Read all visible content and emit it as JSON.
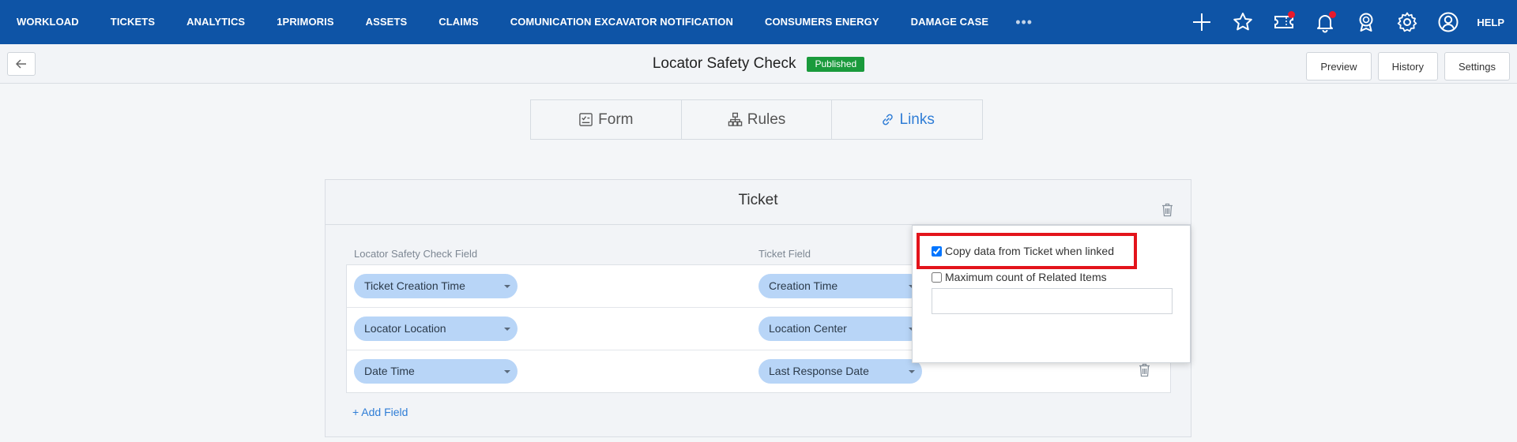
{
  "nav": {
    "items": [
      "WORKLOAD",
      "TICKETS",
      "ANALYTICS",
      "1PRIMORIS",
      "ASSETS",
      "CLAIMS",
      "COMUNICATION EXCAVATOR NOTIFICATION",
      "CONSUMERS ENERGY",
      "DAMAGE CASE"
    ],
    "more": "•••",
    "help": "HELP",
    "icons": [
      "plus-icon",
      "star-icon",
      "ticket-icon",
      "bell-icon",
      "award-icon",
      "gear-icon",
      "user-icon"
    ]
  },
  "header": {
    "title": "Locator Safety Check",
    "status": "Published",
    "buttons": {
      "preview": "Preview",
      "history": "History",
      "settings": "Settings"
    }
  },
  "tabs": [
    {
      "label": "Form",
      "icon": "form-icon",
      "active": false
    },
    {
      "label": "Rules",
      "icon": "rules-icon",
      "active": false
    },
    {
      "label": "Links",
      "icon": "link-icon",
      "active": true
    }
  ],
  "card": {
    "title": "Ticket",
    "col_left": "Locator Safety Check Field",
    "col_right": "Ticket Field",
    "rows": [
      {
        "left": "Ticket Creation Time",
        "right": "Creation Time"
      },
      {
        "left": "Locator Location",
        "right": "Location Center"
      },
      {
        "left": "Date Time",
        "right": "Last Response Date"
      }
    ],
    "add_field": "+ Add Field"
  },
  "popover": {
    "copy_label": "Copy data from Ticket when linked",
    "copy_checked": true,
    "max_label": "Maximum count of Related Items",
    "max_checked": false,
    "max_value": ""
  },
  "colors": {
    "nav_bg": "#0e54a6",
    "published": "#1a9a3c",
    "accent": "#2f7dd6",
    "pill": "#b8d5f7",
    "highlight": "#e3141b"
  }
}
